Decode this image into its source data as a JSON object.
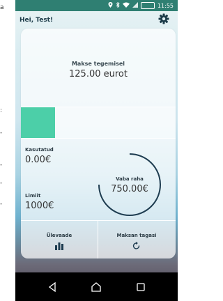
{
  "side_text": [
    "a",
    ":",
    "-",
    "-",
    "-",
    "-"
  ],
  "status_bar": {
    "icons": [
      "location-icon",
      "bluetooth-icon",
      "wifi-icon",
      "signal-icon",
      "battery-icon"
    ],
    "battery_text": "",
    "time": "11:55",
    "color": "#2f7f72"
  },
  "header": {
    "greeting": "Hei, Test!",
    "settings_icon": "gear-icon"
  },
  "payment": {
    "label": "Makse tegemisel",
    "amount": "125.00 eurot"
  },
  "usage_bar": {
    "fill_fraction": 0.22,
    "fill_color": "#4ccfa8"
  },
  "stats": {
    "used_label": "Kasutatud",
    "used_value": "0.00€",
    "limit_label": "Limiit",
    "limit_value": "1000€",
    "available_label": "Vaba raha",
    "available_value": "750.00€",
    "available_fraction": 0.75
  },
  "buttons": {
    "overview_label": "Ülevaade",
    "overview_icon": "bar-chart-icon",
    "repay_label": "Maksan tagasi",
    "repay_icon": "refresh-icon"
  },
  "navbar": {
    "back_icon": "back-icon",
    "home_icon": "home-icon",
    "recents_icon": "recents-icon"
  }
}
